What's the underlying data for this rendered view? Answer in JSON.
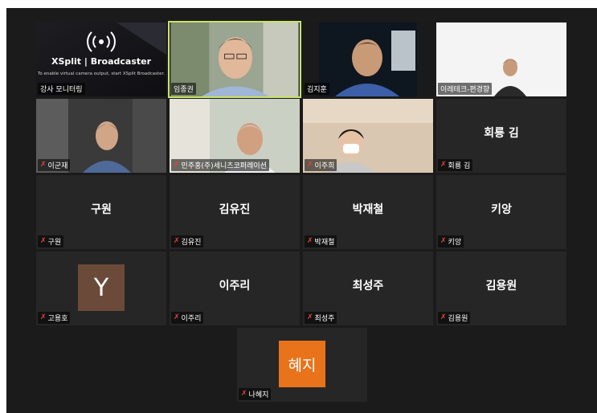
{
  "participants": [
    {
      "name": "강사 모니터링",
      "logo_text": "XSplit | Broadcaster",
      "subtext": "To enable virtual camera output, start XSplit Broadcaster."
    },
    {
      "name": "임종권"
    },
    {
      "name": "김지훈"
    },
    {
      "name": "이레테크-편경향"
    },
    {
      "name": "이군재"
    },
    {
      "name": "민주홍(주)세니츠코퍼레이션"
    },
    {
      "name": "이주희"
    },
    {
      "name": "회룡 김"
    },
    {
      "name": "구원"
    },
    {
      "name": "김유진"
    },
    {
      "name": "박재철"
    },
    {
      "name": "키앙"
    },
    {
      "name": "고용호",
      "initial": "Y"
    },
    {
      "name": "이주리"
    },
    {
      "name": "최성주"
    },
    {
      "name": "김용원"
    },
    {
      "name": "나혜지",
      "initial": "혜지"
    }
  ],
  "icons": {
    "muted_mic": "✗"
  },
  "colors": {
    "active_speaker_border": "#c9e36a",
    "mute_icon": "#e0433a",
    "avatar_y": "#6b4a3a",
    "avatar_hyeji": "#e8731a"
  }
}
